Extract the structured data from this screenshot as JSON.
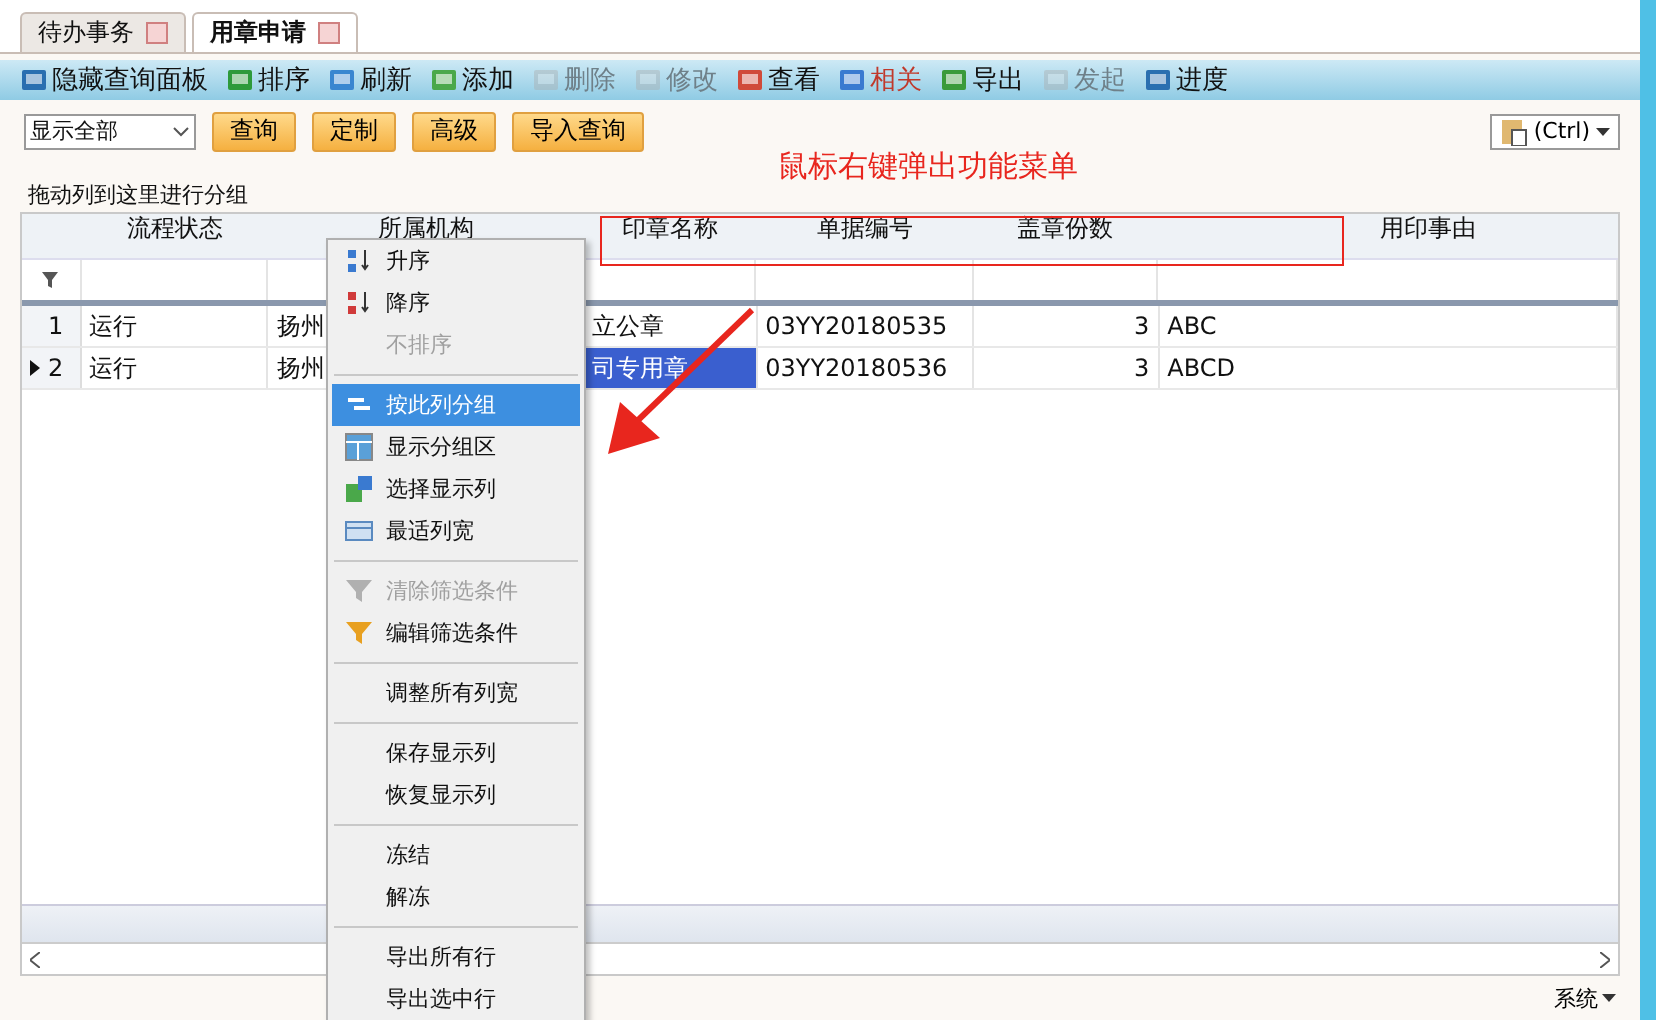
{
  "tabs": [
    {
      "label": "待办事务",
      "selected": false
    },
    {
      "label": "用章申请",
      "selected": true
    }
  ],
  "toolbar": [
    {
      "label": "隐藏查询面板",
      "disabled": false,
      "highlighted": false
    },
    {
      "label": "排序",
      "disabled": false,
      "highlighted": false
    },
    {
      "label": "刷新",
      "disabled": false,
      "highlighted": false
    },
    {
      "label": "添加",
      "disabled": false,
      "highlighted": false
    },
    {
      "label": "删除",
      "disabled": true,
      "highlighted": false
    },
    {
      "label": "修改",
      "disabled": true,
      "highlighted": false
    },
    {
      "label": "查看",
      "disabled": false,
      "highlighted": false
    },
    {
      "label": "相关",
      "disabled": false,
      "highlighted": true
    },
    {
      "label": "导出",
      "disabled": false,
      "highlighted": false
    },
    {
      "label": "发起",
      "disabled": true,
      "highlighted": false
    },
    {
      "label": "进度",
      "disabled": false,
      "highlighted": false
    }
  ],
  "filter": {
    "dropdown": "显示全部",
    "buttons": [
      "查询",
      "定制",
      "高级",
      "导入查询"
    ],
    "paste_button": "(Ctrl)"
  },
  "annotation": "鼠标右键弹出功能菜单",
  "group_panel": "拖动列到这里进行分组",
  "grid": {
    "columns": [
      "流程状态",
      "所属机构",
      "印章名称",
      "单据编号",
      "盖章份数",
      "用印事由"
    ],
    "rows": [
      {
        "number": "1",
        "selected": false,
        "cells": [
          "运行",
          "扬州",
          "立公章",
          "03YY20180535",
          "3",
          "ABC"
        ]
      },
      {
        "number": "2",
        "selected": true,
        "cells": [
          "运行",
          "扬州",
          "司专用章",
          "03YY20180536",
          "3",
          "ABCD"
        ]
      }
    ]
  },
  "context_menu": [
    [
      {
        "label": "升序",
        "disabled": false,
        "selected": false
      },
      {
        "label": "降序",
        "disabled": false,
        "selected": false
      },
      {
        "label": "不排序",
        "disabled": true,
        "selected": false
      }
    ],
    [
      {
        "label": "按此列分组",
        "disabled": false,
        "selected": true
      },
      {
        "label": "显示分组区",
        "disabled": false,
        "selected": false
      },
      {
        "label": "选择显示列",
        "disabled": false,
        "selected": false
      },
      {
        "label": "最适列宽",
        "disabled": false,
        "selected": false
      }
    ],
    [
      {
        "label": "清除筛选条件",
        "disabled": true,
        "selected": false
      },
      {
        "label": "编辑筛选条件",
        "disabled": false,
        "selected": false
      }
    ],
    [
      {
        "label": "调整所有列宽",
        "disabled": false,
        "selected": false
      }
    ],
    [
      {
        "label": "保存显示列",
        "disabled": false,
        "selected": false
      },
      {
        "label": "恢复显示列",
        "disabled": false,
        "selected": false
      }
    ],
    [
      {
        "label": "冻结",
        "disabled": false,
        "selected": false
      },
      {
        "label": "解冻",
        "disabled": false,
        "selected": false
      }
    ],
    [
      {
        "label": "导出所有行",
        "disabled": false,
        "selected": false
      },
      {
        "label": "导出选中行",
        "disabled": false,
        "selected": false
      }
    ]
  ],
  "status": {
    "dropdown": "系统"
  }
}
